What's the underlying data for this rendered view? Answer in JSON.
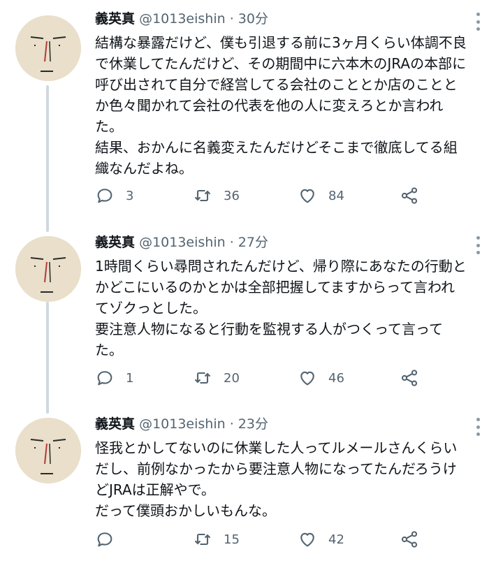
{
  "tweets": [
    {
      "name": "義英真",
      "handle": "@1013eishin",
      "separator": "·",
      "time": "30分",
      "lines": [
        "結構な暴露だけど、僕も引退する前に3ヶ月くらい体調不良",
        "で休業してたんだけど、その期間中に六本木のJRAの本部に",
        "呼び出されて自分で経営してる会社のこととか店のことと",
        "か色々聞かれて会社の代表を他の人に変えろとか言われ",
        "た。",
        "結果、おかんに名義変えたんだけどそこまで徹底してる組",
        "織なんだよね。"
      ],
      "replies": "3",
      "retweets": "36",
      "likes": "84"
    },
    {
      "name": "義英真",
      "handle": "@1013eishin",
      "separator": "·",
      "time": "27分",
      "lines": [
        "1時間くらい尋問されたんだけど、帰り際にあなたの行動と",
        "かどこにいるのかとかは全部把握してますからって言われ",
        "てゾクっとした。",
        "要注意人物になると行動を監視する人がつくって言って",
        "た。"
      ],
      "replies": "1",
      "retweets": "20",
      "likes": "46"
    },
    {
      "name": "義英真",
      "handle": "@1013eishin",
      "separator": "·",
      "time": "23分",
      "lines": [
        "怪我とかしてないのに休業した人ってルメールさんくらい",
        "だし、前例なかったから要注意人物になってたんだろうけ",
        "どJRAは正解やで。",
        "だって僕頭おかしいもんな。"
      ],
      "replies": "",
      "retweets": "15",
      "likes": "42"
    }
  ],
  "icons": {
    "avatar": "cartoon-face-avatar",
    "more": "more-vertical-icon",
    "reply": "reply-bubble-icon",
    "retweet": "retweet-icon",
    "like": "heart-icon",
    "share": "share-icon"
  },
  "colors": {
    "text": "#0f1419",
    "secondary": "#536471",
    "thread_line": "#cfd9de",
    "avatar_bg": "#e9dfca"
  }
}
